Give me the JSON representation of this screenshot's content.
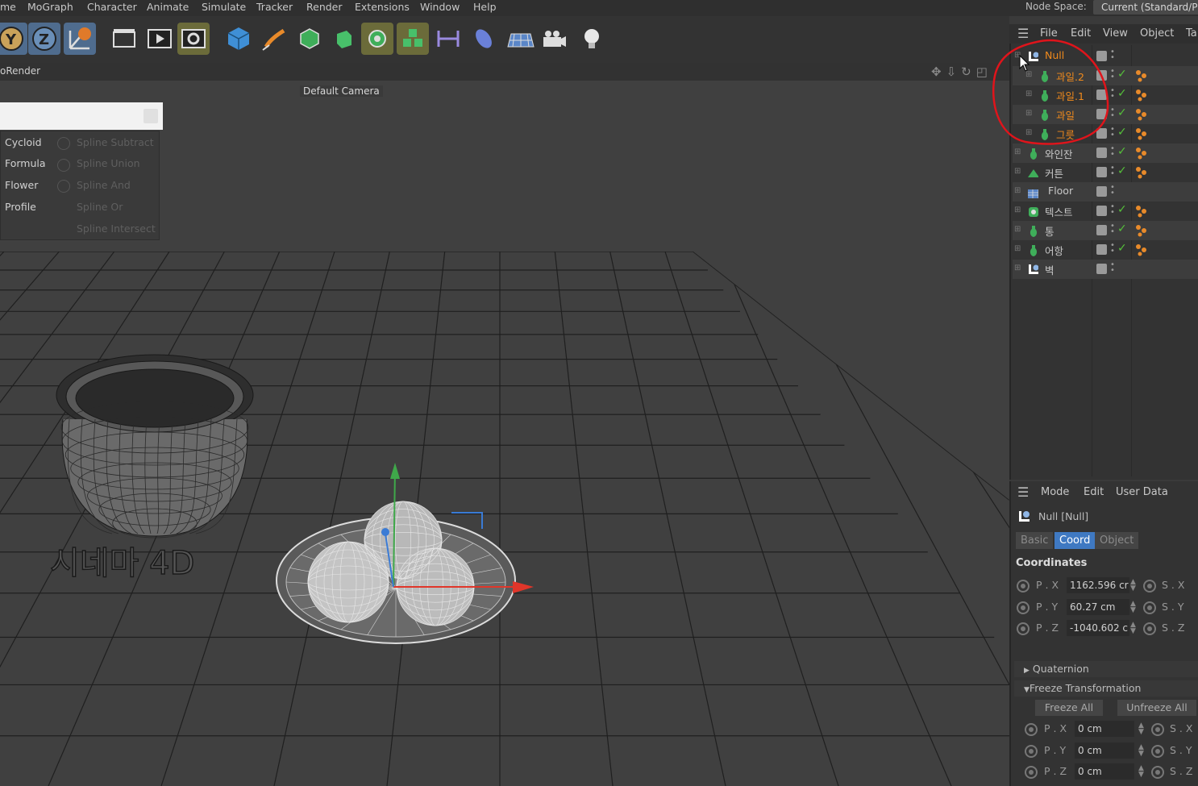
{
  "menubar": {
    "items": [
      "me",
      "MoGraph",
      "Character",
      "Animate",
      "Simulate",
      "Tracker",
      "Render",
      "Extensions",
      "Window",
      "Help"
    ],
    "node_space_label": "Node Space:",
    "node_space_value": "Current (Standard/P"
  },
  "toolbar": {
    "icons": [
      "axis-y-lock-icon",
      "axis-z-lock-icon",
      "coordinate-system-icon",
      "render-region-icon",
      "render-to-picture-viewer-icon",
      "render-settings-icon",
      "cube-icon",
      "pen-icon",
      "subdivision-icon",
      "extrude-icon",
      "cloner-icon",
      "array-icon",
      "mirror-icon",
      "deformer-icon",
      "floor-icon",
      "camera-icon",
      "light-icon"
    ]
  },
  "viewport": {
    "header_title": "oRender",
    "camera_label": "Default Camera",
    "watermark_text": "시네마 4D"
  },
  "spline_popup": {
    "left_items": [
      "Cycloid",
      "Formula",
      "Flower",
      "Profile"
    ],
    "right_items": [
      "Spline Subtract",
      "Spline Union",
      "Spline And",
      "Spline Or",
      "Spline Intersect"
    ]
  },
  "object_manager": {
    "menu": [
      "File",
      "Edit",
      "View",
      "Object",
      "Ta"
    ],
    "rows": [
      {
        "name": "Null",
        "highlight": true,
        "indent": 0,
        "icon": "null-icon",
        "check": false,
        "tag": false
      },
      {
        "name": "과일.2",
        "highlight": true,
        "indent": 1,
        "icon": "bottle-icon",
        "check": true,
        "tag": true
      },
      {
        "name": "과일.1",
        "highlight": true,
        "indent": 1,
        "icon": "bottle-icon",
        "check": true,
        "tag": true
      },
      {
        "name": "과일",
        "highlight": true,
        "indent": 1,
        "icon": "bottle-icon",
        "check": true,
        "tag": true
      },
      {
        "name": "그릇",
        "highlight": true,
        "indent": 1,
        "icon": "bottle-icon",
        "check": true,
        "tag": true
      },
      {
        "name": "와인잔",
        "highlight": false,
        "indent": 0,
        "icon": "bottle-icon",
        "check": true,
        "tag": true
      },
      {
        "name": "커튼",
        "highlight": false,
        "indent": 0,
        "icon": "cloth-icon",
        "check": true,
        "tag": true
      },
      {
        "name": "Floor",
        "highlight": false,
        "indent": 0,
        "icon": "floor-icon",
        "check": false,
        "tag": false
      },
      {
        "name": "텍스트",
        "highlight": false,
        "indent": 0,
        "icon": "text-icon",
        "check": true,
        "tag": true
      },
      {
        "name": "통",
        "highlight": false,
        "indent": 0,
        "icon": "bottle-icon",
        "check": true,
        "tag": true
      },
      {
        "name": "어항",
        "highlight": false,
        "indent": 0,
        "icon": "bottle-icon",
        "check": true,
        "tag": true
      },
      {
        "name": "벽",
        "highlight": false,
        "indent": 0,
        "icon": "null-icon",
        "check": false,
        "tag": false
      }
    ]
  },
  "attribute_manager": {
    "menu": [
      "Mode",
      "Edit",
      "User Data"
    ],
    "object_name": "Null [Null]",
    "tabs": [
      "Basic",
      "Coord",
      "Object"
    ],
    "active_tab": "Coord",
    "section_title": "Coordinates",
    "coords": [
      {
        "label": "P . X",
        "value": "1162.596 cr",
        "scale_label": "S . X"
      },
      {
        "label": "P . Y",
        "value": "60.27 cm",
        "scale_label": "S . Y"
      },
      {
        "label": "P . Z",
        "value": "-1040.602 c",
        "scale_label": "S . Z"
      }
    ],
    "quaternion_label": "Quaternion",
    "freeze_label": "Freeze Transformation",
    "freeze_all": "Freeze All",
    "unfreeze_all": "Unfreeze All",
    "freeze_coords": [
      {
        "label": "P . X",
        "value": "0 cm",
        "scale_label": "S . X"
      },
      {
        "label": "P . Y",
        "value": "0 cm",
        "scale_label": "S . Y"
      },
      {
        "label": "P . Z",
        "value": "0 cm",
        "scale_label": "S . Z"
      }
    ]
  },
  "colors": {
    "accent_blue": "#3f79c2",
    "highlight_orange": "#f08a1c",
    "annotation_red": "#e0141b",
    "check_green": "#55c03a"
  }
}
